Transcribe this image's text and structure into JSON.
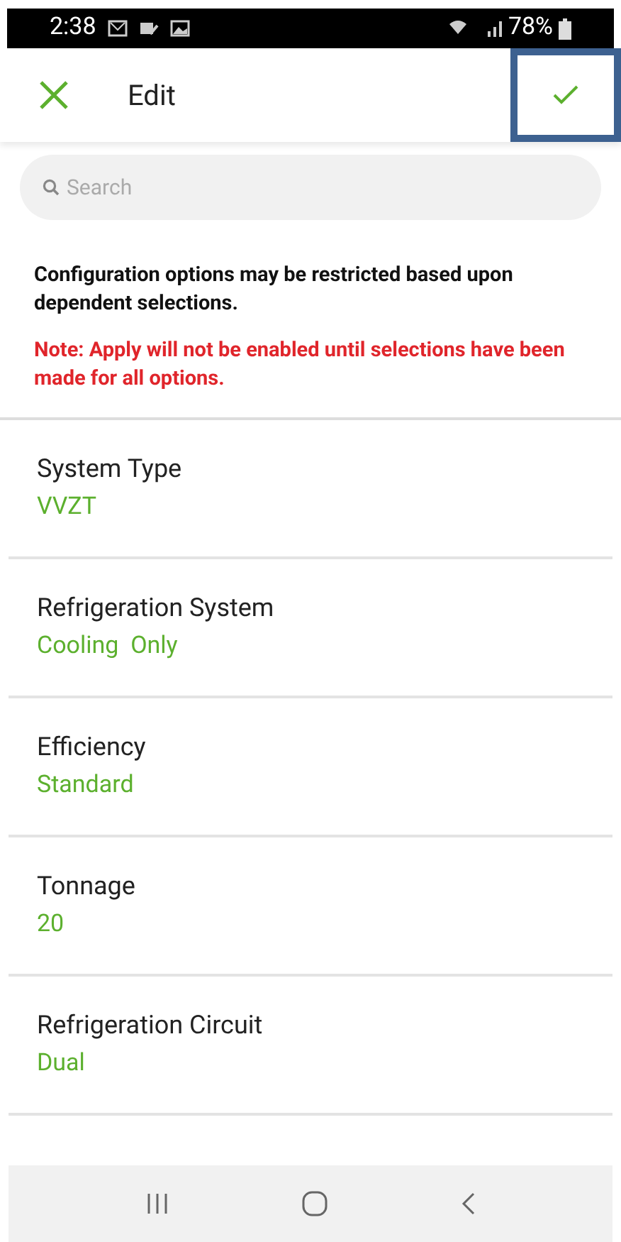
{
  "status_bar": {
    "time": "2:38",
    "battery": "78%"
  },
  "header": {
    "title": "Edit"
  },
  "search": {
    "placeholder": "Search"
  },
  "info": {
    "text": "Configuration options may be restricted based upon dependent selections.",
    "note": "Note: Apply will not be enabled until selections have been made for all options."
  },
  "options": [
    {
      "label": "System Type",
      "value": "VVZT"
    },
    {
      "label": "Refrigeration System",
      "value": "Cooling  Only"
    },
    {
      "label": "Efficiency",
      "value": "Standard"
    },
    {
      "label": "Tonnage",
      "value": "20"
    },
    {
      "label": "Refrigeration Circuit",
      "value": "Dual"
    }
  ]
}
